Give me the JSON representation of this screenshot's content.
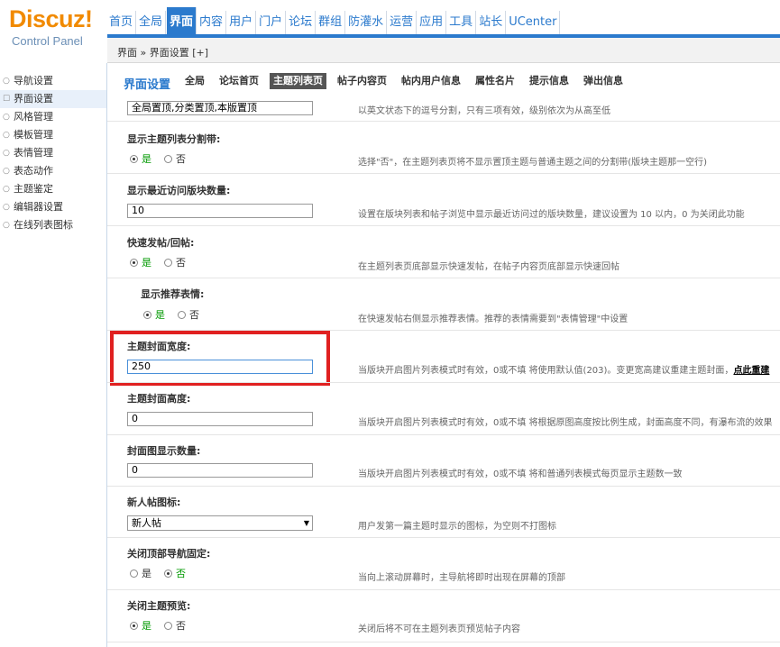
{
  "logo": {
    "brand": "Discuz!",
    "subtitle": "Control Panel"
  },
  "topnav": [
    {
      "label": "首页",
      "active": false
    },
    {
      "label": "全局",
      "active": false
    },
    {
      "label": "界面",
      "active": true
    },
    {
      "label": "内容",
      "active": false
    },
    {
      "label": "用户",
      "active": false
    },
    {
      "label": "门户",
      "active": false
    },
    {
      "label": "论坛",
      "active": false
    },
    {
      "label": "群组",
      "active": false
    },
    {
      "label": "防灌水",
      "active": false
    },
    {
      "label": "运营",
      "active": false
    },
    {
      "label": "应用",
      "active": false
    },
    {
      "label": "工具",
      "active": false
    },
    {
      "label": "站长",
      "active": false
    },
    {
      "label": "UCenter",
      "active": false
    }
  ],
  "breadcrumb": "界面 » 界面设置  [+]",
  "sidebar": [
    {
      "label": "导航设置",
      "active": false
    },
    {
      "label": "界面设置",
      "active": true
    },
    {
      "label": "风格管理",
      "active": false
    },
    {
      "label": "模板管理",
      "active": false
    },
    {
      "label": "表情管理",
      "active": false
    },
    {
      "label": "表态动作",
      "active": false
    },
    {
      "label": "主题鉴定",
      "active": false
    },
    {
      "label": "编辑器设置",
      "active": false
    },
    {
      "label": "在线列表图标",
      "active": false
    }
  ],
  "subnav": {
    "title": "界面设置",
    "tabs": [
      {
        "label": "全局",
        "active": false
      },
      {
        "label": "论坛首页",
        "active": false
      },
      {
        "label": "主题列表页",
        "active": true
      },
      {
        "label": "帖子内容页",
        "active": false
      },
      {
        "label": "帖内用户信息",
        "active": false
      },
      {
        "label": "属性名片",
        "active": false
      },
      {
        "label": "提示信息",
        "active": false
      },
      {
        "label": "弹出信息",
        "active": false
      }
    ]
  },
  "settings": {
    "top": {
      "value": "全局置顶,分类置顶,本版置顶",
      "desc": "以英文状态下的逗号分割，只有三项有效，级别依次为从高至低"
    },
    "separator": {
      "label": "显示主题列表分割带:",
      "yes": "是",
      "no": "否",
      "desc": "选择\"否\"，在主题列表页将不显示置顶主题与普通主题之间的分割带(版块主题那一空行)"
    },
    "recent": {
      "label": "显示最近访问版块数量:",
      "value": "10",
      "desc": "设置在版块列表和帖子浏览中显示最近访问过的版块数量，建议设置为 10 以内，0 为关闭此功能"
    },
    "quickpost": {
      "label": "快速发帖/回帖:",
      "yes": "是",
      "no": "否",
      "desc": "在主题列表页底部显示快速发帖，在帖子内容页底部显示快速回帖"
    },
    "smilies": {
      "label": "显示推荐表情:",
      "yes": "是",
      "no": "否",
      "desc": "在快速发帖右侧显示推荐表情。推荐的表情需要到\"表情管理\"中设置"
    },
    "coverwidth": {
      "label": "主题封面宽度:",
      "value": "250",
      "desc": "当版块开启图片列表模式时有效，0或不填 将使用默认值(203)。变更宽高建议重建主题封面，",
      "link": "点此重建"
    },
    "coverheight": {
      "label": "主题封面高度:",
      "value": "0",
      "desc": "当版块开启图片列表模式时有效，0或不填 将根据原图高度按比例生成，封面高度不同，有瀑布流的效果"
    },
    "covercount": {
      "label": "封面图显示数量:",
      "value": "0",
      "desc": "当版块开启图片列表模式时有效，0或不填 将和普通列表模式每页显示主题数一致"
    },
    "newicon": {
      "label": "新人帖图标:",
      "value": "新人帖",
      "desc": "用户发第一篇主题时显示的图标，为空则不打图标"
    },
    "fixnav": {
      "label": "关闭顶部导航固定:",
      "yes": "是",
      "no": "否",
      "desc": "当向上滚动屏幕时，主导航将即时出现在屏幕的顶部"
    },
    "preview": {
      "label": "关闭主题预览:",
      "yes": "是",
      "no": "否",
      "desc": "关闭后将不可在主题列表页预览帖子内容"
    }
  },
  "colors": {
    "accent": "#2b7acd",
    "brand": "#f18a00",
    "highlight_box": "#e02020",
    "yes_green": "#009900"
  }
}
